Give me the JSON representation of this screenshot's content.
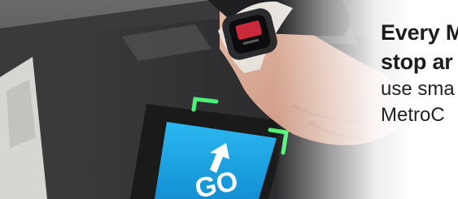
{
  "hero": {
    "headline_line1": "Every M",
    "headline_line2": "stop ar",
    "body_line1": "use sma",
    "body_line2": "MetroC",
    "screen_text": "GO",
    "colors": {
      "screen_blue": "#1aa6e6",
      "indicator_green": "#4dff7a",
      "skin": "#d9a892",
      "watch_band": "#e8e2dc"
    },
    "icons": [
      "smartwatch-icon",
      "arrow-up-left-icon"
    ]
  }
}
